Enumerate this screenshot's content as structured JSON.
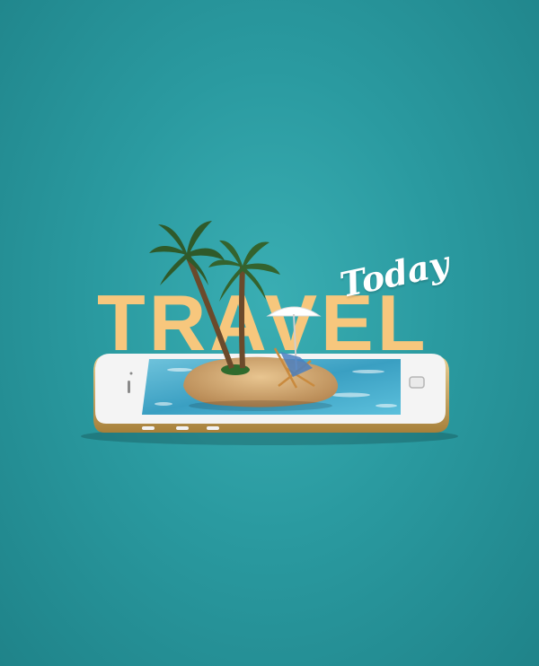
{
  "poster": {
    "title": "TRAVEL",
    "subtitle": "Today"
  },
  "colors": {
    "background": "#2a9aa0",
    "title": "#f7c77d",
    "subtitle": "#ffffff",
    "phone_body": "#f3f3f3",
    "phone_gold": "#c9a45c",
    "water": "#3fa7c9",
    "sand": "#d9b07a",
    "palm": "#2f5a2a"
  },
  "icons": [
    "palm-tree-icon",
    "beach-umbrella-icon",
    "deck-chair-icon",
    "smartphone-icon"
  ]
}
